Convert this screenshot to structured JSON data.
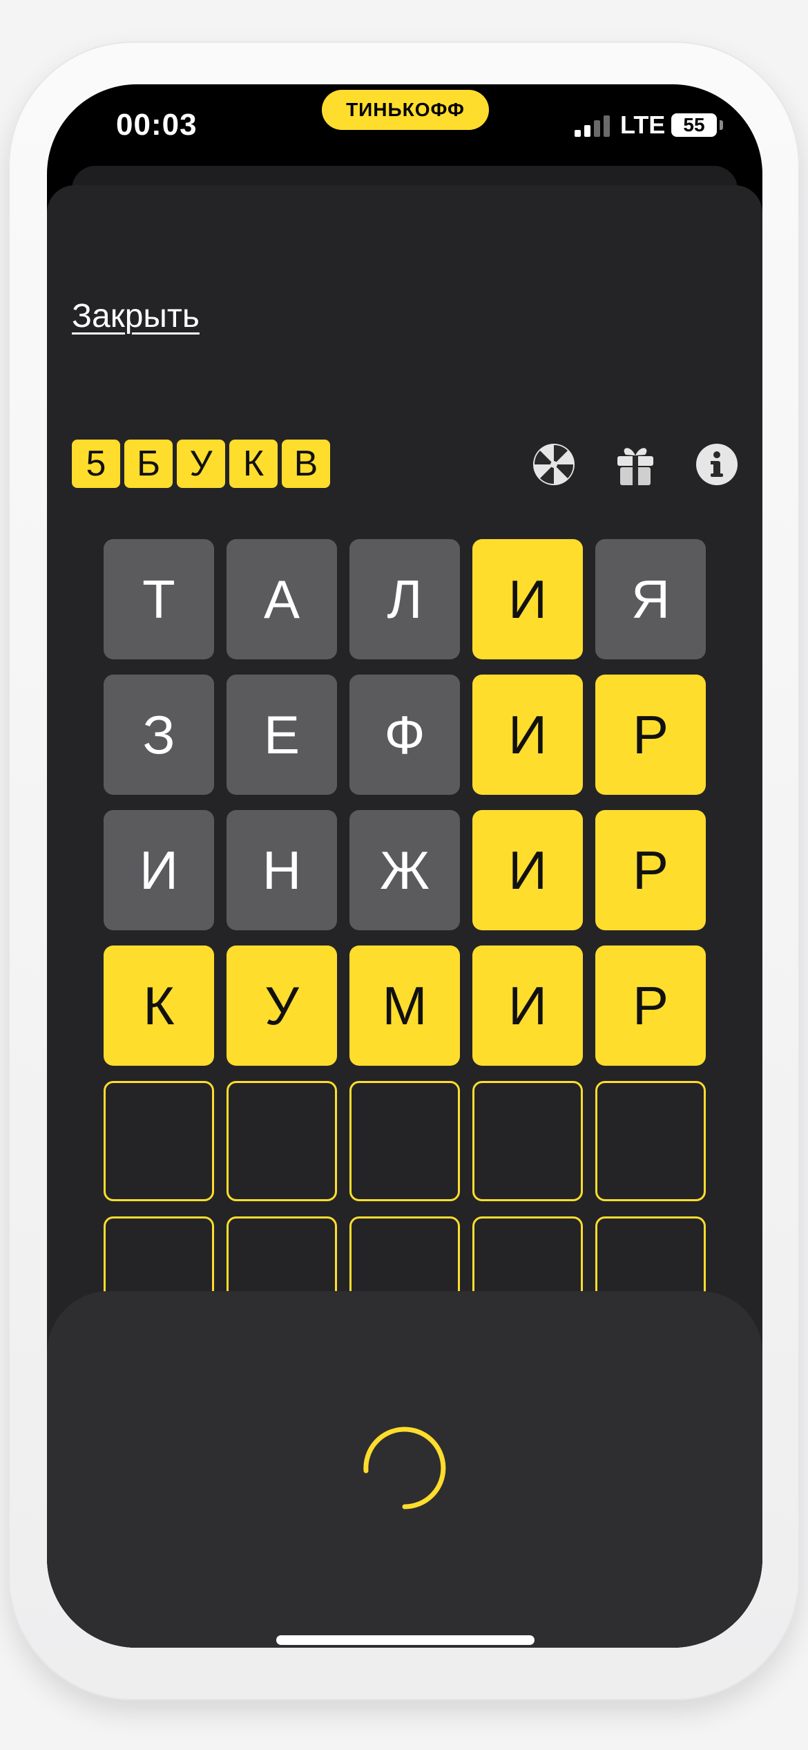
{
  "status_bar": {
    "time": "00:03",
    "brand": "ТИНЬКОФФ",
    "network": "LTE",
    "battery": "55"
  },
  "header": {
    "close_label": "Закрыть",
    "logo_letters": [
      "5",
      "Б",
      "У",
      "К",
      "В"
    ]
  },
  "toolbar": {
    "icons": [
      "wheel-icon",
      "gift-icon",
      "info-icon"
    ]
  },
  "board": {
    "rows": [
      [
        {
          "l": "Т",
          "s": "gray"
        },
        {
          "l": "А",
          "s": "gray"
        },
        {
          "l": "Л",
          "s": "gray"
        },
        {
          "l": "И",
          "s": "yellow"
        },
        {
          "l": "Я",
          "s": "gray"
        }
      ],
      [
        {
          "l": "З",
          "s": "gray"
        },
        {
          "l": "Е",
          "s": "gray"
        },
        {
          "l": "Ф",
          "s": "gray"
        },
        {
          "l": "И",
          "s": "yellow"
        },
        {
          "l": "Р",
          "s": "yellow"
        }
      ],
      [
        {
          "l": "И",
          "s": "gray"
        },
        {
          "l": "Н",
          "s": "gray"
        },
        {
          "l": "Ж",
          "s": "gray"
        },
        {
          "l": "И",
          "s": "yellow"
        },
        {
          "l": "Р",
          "s": "yellow"
        }
      ],
      [
        {
          "l": "К",
          "s": "yellow"
        },
        {
          "l": "У",
          "s": "yellow"
        },
        {
          "l": "М",
          "s": "yellow"
        },
        {
          "l": "И",
          "s": "yellow"
        },
        {
          "l": "Р",
          "s": "yellow"
        }
      ],
      [
        {
          "l": "",
          "s": "empty"
        },
        {
          "l": "",
          "s": "empty"
        },
        {
          "l": "",
          "s": "empty"
        },
        {
          "l": "",
          "s": "empty"
        },
        {
          "l": "",
          "s": "empty"
        }
      ],
      [
        {
          "l": "",
          "s": "empty"
        },
        {
          "l": "",
          "s": "empty"
        },
        {
          "l": "",
          "s": "empty"
        },
        {
          "l": "",
          "s": "empty"
        },
        {
          "l": "",
          "s": "empty"
        }
      ]
    ]
  },
  "colors": {
    "accent": "#ffdd2d",
    "tile_gray": "#5b5b5e",
    "sheet": "#242426",
    "panel": "#2e2e30"
  }
}
